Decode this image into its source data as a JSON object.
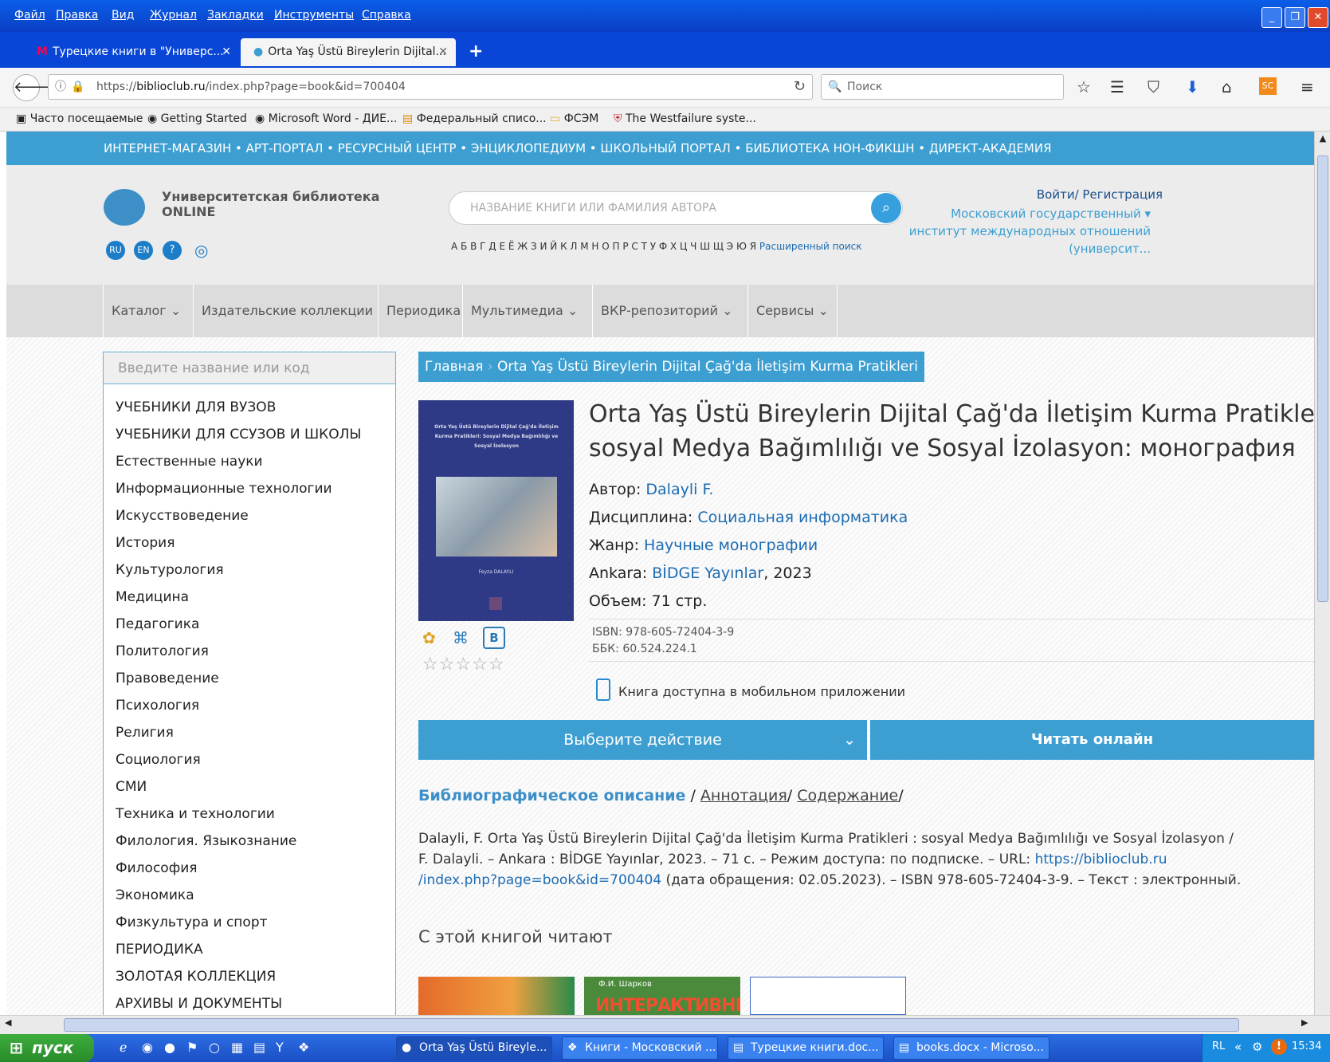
{
  "menubar": {
    "items": [
      "Файл",
      "Правка",
      "Вид",
      "Журнал",
      "Закладки",
      "Инструменты",
      "Справка"
    ]
  },
  "tabs": [
    {
      "label": "Турецкие книги в \"Универс..."
    },
    {
      "label": "Orta Yaş Üstü Bireylerin Dijital..."
    }
  ],
  "nav": {
    "url_prefix": "https://",
    "url_host": "biblioclub.ru",
    "url_rest": "/index.php?page=book&id=700404",
    "search_placeholder": "Поиск"
  },
  "bookmarks": [
    "Часто посещаемые",
    "Getting Started",
    "Microsoft Word - ДИЕ...",
    "Федеральный списо...",
    "ФСЭМ",
    "The Westfailure syste..."
  ],
  "portals": "ИНТЕРНЕТ-МАГАЗИН • АРТ-ПОРТАЛ • РЕСУРСНЫЙ ЦЕНТР • ЭНЦИКЛОПЕДИУМ • ШКОЛЬНЫЙ ПОРТАЛ • БИБЛИОТЕКА НОН-ФИКШН • ДИРЕКТ-АКАДЕМИЯ",
  "header": {
    "logo_line1": "Университетская библиотека",
    "logo_line2": "ONLINE",
    "lang_ru": "RU",
    "lang_en": "EN",
    "help": "?",
    "search_placeholder": "НАЗВАНИЕ КНИГИ ИЛИ ФАМИЛИЯ АВТОРА",
    "alphabet": "А Б В Г Д Е Ё Ж З И Й К Л М Н О П Р С Т У Ф Х Ц Ч Ш Щ Э Ю Я",
    "advanced": "Расширенный поиск",
    "login": "Войти/ Регистрация",
    "institution": [
      "Московский государственный ▾",
      "институт международных отношений",
      "(университ..."
    ]
  },
  "mainmenu": [
    "Каталог",
    "Издательские коллекции",
    "Периодика",
    "Мультимедиа",
    "ВКР-репозиторий",
    "Сервисы"
  ],
  "sidebar": {
    "placeholder": "Введите название или код",
    "items": [
      "УЧЕБНИКИ ДЛЯ ВУЗОВ",
      "УЧЕБНИКИ ДЛЯ ССУЗОВ И ШКОЛЫ",
      "Естественные науки",
      "Информационные технологии",
      "Искусствоведение",
      "История",
      "Культурология",
      "Медицина",
      "Педагогика",
      "Политология",
      "Правоведение",
      "Психология",
      "Религия",
      "Социология",
      "СМИ",
      "Техника и технологии",
      "Филология. Языкознание",
      "Философия",
      "Экономика",
      "Физкультура и спорт",
      "ПЕРИОДИКА",
      "ЗОЛОТАЯ КОЛЛЕКЦИЯ",
      "АРХИВЫ И ДОКУМЕНТЫ"
    ]
  },
  "breadcrumb": {
    "home": "Главная",
    "current": "Orta Yaş Üstü Bireylerin Dijital Çağ'da İletişim Kurma Pratikleri"
  },
  "book": {
    "title_line1": "Orta Yaş Üstü Bireylerin Dijital Çağ'da İletişim Kurma Pratikleri :",
    "title_line2": "sosyal Medya Bağımlılığı ve Sosyal İzolasyon: монография",
    "author_label": "Автор:",
    "author": "Dalayli F.",
    "discipline_label": "Дисциплина:",
    "discipline": "Социальная информатика",
    "genre_label": "Жанр:",
    "genre": "Научные монографии",
    "city": "Ankara:",
    "publisher": "BİDGE Yayınlar",
    "year": ", 2023",
    "volume": "Объем: 71 стр.",
    "isbn": "ISBN: 978-605-72404-3-9",
    "bbk": "ББК: 60.524.224.1",
    "mobile": "Книга доступна в мобильном приложении",
    "cover_title": "Orta Yaş Üstü Bireylerin Dijital Çağ'da İletişim Kurma Pratikleri: Sosyal Medya Bağımlılığı ve Sosyal İzolasyon",
    "cover_author": "Feyza DALAYLI",
    "rating_stars": "☆☆☆☆☆"
  },
  "actions": {
    "choose": "Выберите действие",
    "read": "Читать онлайн"
  },
  "desc_tabs": {
    "biblio": "Библиографическое описание",
    "sep1": "/",
    "annotation": "Аннотация",
    "sep2": "/",
    "contents": "Содержание",
    "sep3": "/"
  },
  "citation": {
    "line1": "Dalayli, F. Orta Yaş Üstü Bireylerin Dijital Çağ'da İletişim Kurma Pratikleri : sosyal Medya Bağımlılığı ve Sosyal İzolasyon /",
    "line2a": "F. Dalayli. – Ankara : BİDGE Yayınlar, 2023. – 71 с. – Режим доступа: по подписке. – URL: ",
    "line2b": "https://biblioclub.ru",
    "line3a": "/index.php?page=book&id=700404",
    "line3b": " (дата обращения: 02.05.2023). – ISBN 978-605-72404-3-9. – Текст : электронный."
  },
  "related": {
    "heading": "С этой книгой читают",
    "book2_author": "Ф.И. Шарков",
    "book2_title": "ИНТЕРАКТИВНЫЕ"
  },
  "taskbar": {
    "start": "пуск",
    "tasks": [
      "Orta Yaş Üstü Bireyle...",
      "Книги - Московский ...",
      "Турецкие книги.doc...",
      "books.docx - Microso..."
    ],
    "lang": "RL",
    "time": "15:34"
  }
}
